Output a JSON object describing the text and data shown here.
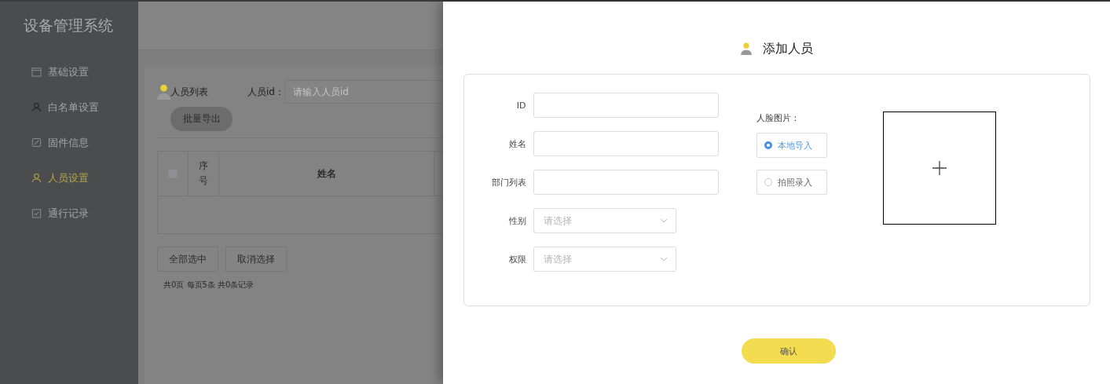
{
  "sidebar": {
    "title": "设备管理系统",
    "items": [
      {
        "label": "基础设置",
        "selected": false
      },
      {
        "label": "白名单设置",
        "selected": false
      },
      {
        "label": "固件信息",
        "selected": false
      },
      {
        "label": "人员设置",
        "selected": true
      },
      {
        "label": "通行记录",
        "selected": false
      }
    ]
  },
  "list_page": {
    "title": "人员列表",
    "search_label": "人员id：",
    "search_placeholder": "请输入人员id",
    "export_button": "批量导出",
    "table": {
      "header_checkbox": {
        "checked": false
      },
      "columns": [
        "序号",
        "姓名"
      ]
    },
    "buttons": [
      "全部选中",
      "取消选择"
    ],
    "pagination": "共0页  每页5条  共0条记录"
  },
  "dialog": {
    "title": "添加人员",
    "fields": [
      {
        "kind": "text",
        "label": "ID"
      },
      {
        "kind": "text",
        "label": "姓名"
      },
      {
        "kind": "text",
        "label": "部门列表"
      },
      {
        "kind": "select",
        "label": "性别",
        "placeholder": "请选择"
      },
      {
        "kind": "select",
        "label": "权限",
        "placeholder": "请选择"
      }
    ],
    "face": {
      "label": "人脸图片：",
      "options": [
        {
          "label": "本地导入",
          "selected": true
        },
        {
          "label": "拍照录入",
          "selected": false
        }
      ]
    },
    "confirm": "确认"
  }
}
